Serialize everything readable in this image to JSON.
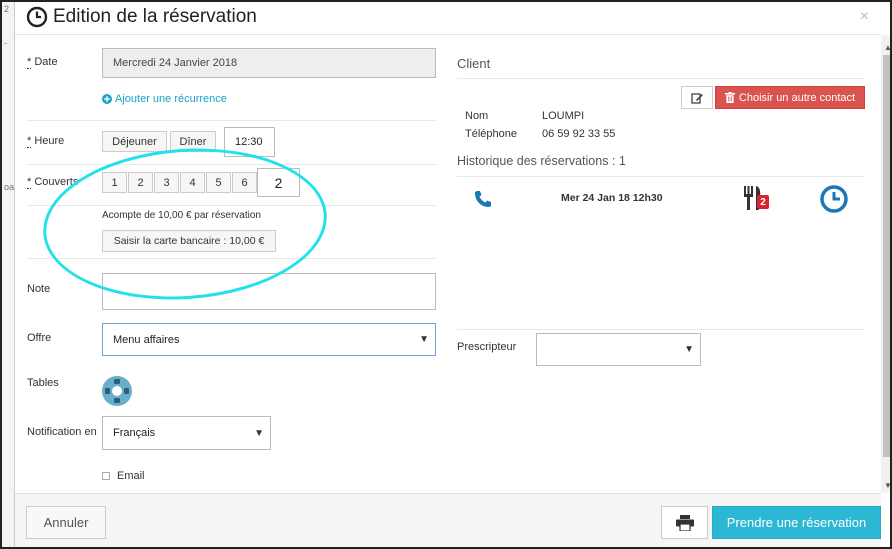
{
  "bg": {
    "frag1": "2",
    "frag2": "-",
    "frag3": "oa"
  },
  "header": {
    "title": "Edition de la réservation",
    "close": "×"
  },
  "form": {
    "date": {
      "label": "Date",
      "value": "Mercredi 24 Janvier 2018"
    },
    "recurrence_link": "Ajouter une récurrence",
    "heure": {
      "label": "Heure",
      "dejeuner": "Déjeuner",
      "diner": "Dîner",
      "value": "12:30"
    },
    "couverts": {
      "label": "Couverts",
      "options": [
        "1",
        "2",
        "3",
        "4",
        "5",
        "6"
      ],
      "value": "2"
    },
    "acompte_text": "Acompte de 10,00 € par réservation",
    "carte_button": "Saisir la carte bancaire : 10,00 €",
    "note": {
      "label": "Note",
      "value": ""
    },
    "offre": {
      "label": "Offre",
      "value": "Menu affaires"
    },
    "tables": {
      "label": "Tables"
    },
    "notification": {
      "label": "Notification en",
      "value": "Français"
    },
    "email": {
      "label": "Email",
      "checked": false
    }
  },
  "client": {
    "heading": "Client",
    "edit_icon": "edit-icon",
    "choose_contact": "Choisir un autre contact",
    "nom_label": "Nom",
    "nom_value": "LOUMPI",
    "tel_label": "Téléphone",
    "tel_value": "06 59 92 33 55",
    "historique": "Historique des réservations : 1",
    "history_item": {
      "date": "Mer 24 Jan 18 12h30",
      "badge": "2"
    },
    "prescripteur_label": "Prescripteur",
    "prescripteur_value": ""
  },
  "footer": {
    "cancel": "Annuler",
    "submit": "Prendre une réservation"
  },
  "colors": {
    "accent": "#1aa3c7",
    "danger": "#d9534f",
    "highlight": "#22e0ee",
    "primary": "#2cb7d4"
  }
}
